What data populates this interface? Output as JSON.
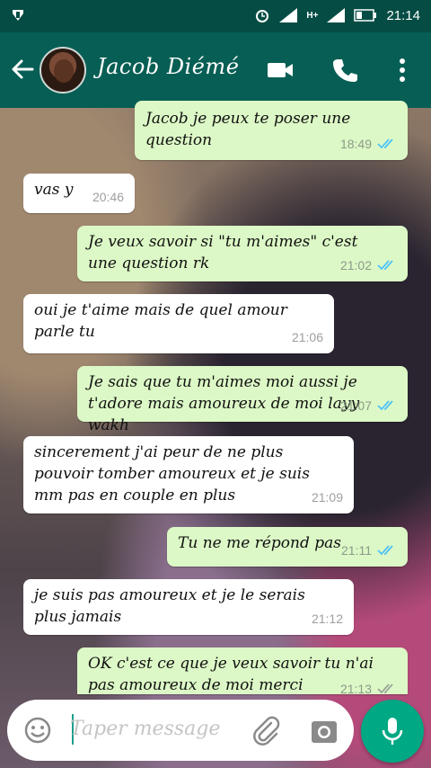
{
  "status_bar": {
    "time": "21:14",
    "network": "H+"
  },
  "header": {
    "contact_name": "Jacob Diémé"
  },
  "messages": [
    {
      "direction": "out",
      "text": "Jacob je peux te poser une question",
      "time": "18:49",
      "read": true
    },
    {
      "direction": "in",
      "text": "vas y",
      "time": "20:46"
    },
    {
      "direction": "out",
      "text": "Je veux savoir si \"tu m'aimes\" c'est une question rk",
      "time": "21:02",
      "read": true
    },
    {
      "direction": "in",
      "text": "oui je t'aime mais de quel amour parle tu",
      "time": "21:06"
    },
    {
      "direction": "out",
      "text": "Je sais que tu m'aimes moi aussi je t'adore mais amoureux de moi layy wakh",
      "time": "21:07",
      "read": true
    },
    {
      "direction": "in",
      "text": "sincerement j'ai peur de ne plus pouvoir tomber amoureux et je suis mm pas en couple en plus",
      "time": "21:09"
    },
    {
      "direction": "out",
      "text": "Tu ne me répond pas",
      "time": "21:11",
      "read": true
    },
    {
      "direction": "in",
      "text": "je suis pas amoureux et je le serais plus jamais",
      "time": "21:12"
    },
    {
      "direction": "out",
      "text": "OK c'est ce que je veux savoir tu n'ai pas amoureux de moi merci",
      "time": "21:13",
      "read": false
    }
  ],
  "composer": {
    "placeholder": "Taper message"
  },
  "colors": {
    "header": "#075e54",
    "status_bar": "#054d44",
    "outgoing": "#dcf8c6",
    "incoming": "#ffffff",
    "accent": "#00a884",
    "read_ticks": "#4fc3f7"
  }
}
